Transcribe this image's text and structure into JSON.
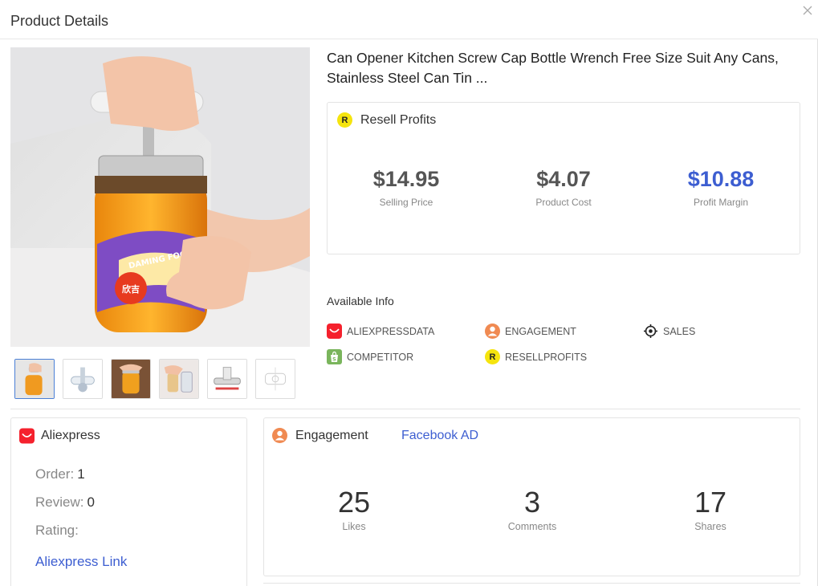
{
  "modal": {
    "title": "Product Details"
  },
  "product": {
    "title": "Can Opener Kitchen Screw Cap Bottle Wrench Free Size Suit Any Cans, Stainless Steel Can Tin ...",
    "image_caption": "DAMING FOOD",
    "thumbnail_count": 6
  },
  "resell": {
    "header": "Resell Profits",
    "badge": "R",
    "selling_price": "$14.95",
    "selling_price_label": "Selling Price",
    "product_cost": "$4.07",
    "product_cost_label": "Product Cost",
    "profit_margin": "$10.88",
    "profit_margin_label": "Profit Margin",
    "accent_color": "#3d5ed1"
  },
  "available_info": {
    "title": "Available Info",
    "items": [
      {
        "label": "ALIEXPRESSDATA",
        "icon": "aliexpress-icon"
      },
      {
        "label": "ENGAGEMENT",
        "icon": "engagement-user-icon"
      },
      {
        "label": "SALES",
        "icon": "crosshair-icon"
      },
      {
        "label": "COMPETITOR",
        "icon": "shopify-bag-icon"
      },
      {
        "label": "RESELLPROFITS",
        "icon": "resell-badge-icon"
      }
    ]
  },
  "aliexpress": {
    "header": "Aliexpress",
    "order_label": "Order:",
    "order_value": "1",
    "review_label": "Review:",
    "review_value": "0",
    "rating_label": "Rating:",
    "link_label": "Aliexpress Link"
  },
  "engagement": {
    "header": "Engagement",
    "link_label": "Facebook AD",
    "likes": "25",
    "likes_label": "Likes",
    "comments": "3",
    "comments_label": "Comments",
    "shares": "17",
    "shares_label": "Shares"
  }
}
